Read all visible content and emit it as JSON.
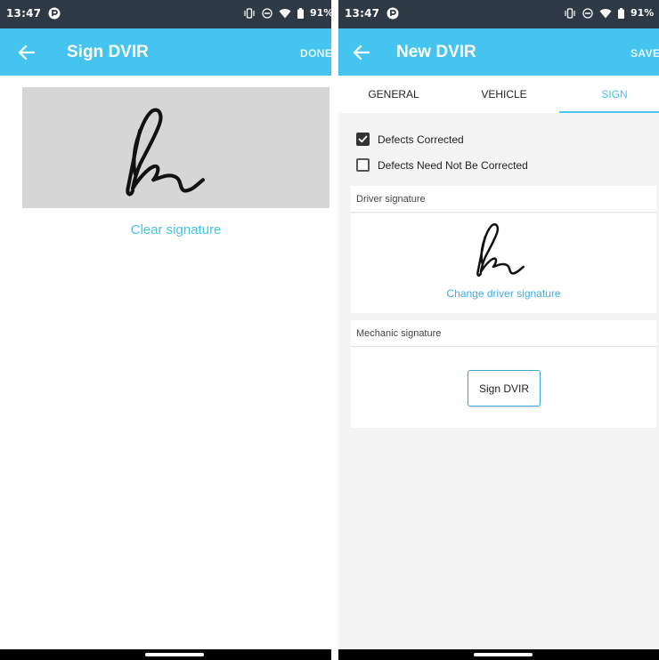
{
  "status_bar": {
    "time": "13:47",
    "battery": "91%",
    "icons": [
      "app-notification-icon",
      "vibrate-icon",
      "do-not-disturb-icon",
      "wifi-icon",
      "battery-icon"
    ]
  },
  "sign_screen": {
    "title": "Sign DVIR",
    "done_label": "DONE",
    "clear_label": "Clear signature"
  },
  "dvir_screen": {
    "title": "New DVIR",
    "save_label": "SAVE",
    "tabs": [
      {
        "label": "GENERAL",
        "active": false
      },
      {
        "label": "VEHICLE",
        "active": false
      },
      {
        "label": "SIGN",
        "active": true
      }
    ],
    "checkboxes": [
      {
        "label": "Defects Corrected",
        "checked": true
      },
      {
        "label": "Defects Need Not Be Corrected",
        "checked": false
      }
    ],
    "driver_signature": {
      "header": "Driver signature",
      "change_label": "Change driver signature"
    },
    "mechanic_signature": {
      "header": "Mechanic signature",
      "sign_button_label": "Sign DVIR"
    }
  },
  "colors": {
    "accent": "#44c4ee",
    "status_bar": "#2d3a45",
    "signature_pad": "#d6d6d6",
    "navigation_bar": "#000000"
  }
}
